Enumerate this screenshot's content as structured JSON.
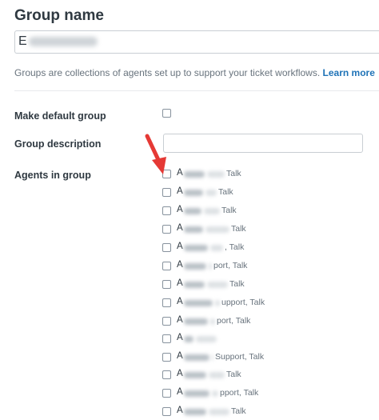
{
  "group_name": {
    "label": "Group name",
    "value_visible_prefix": "E"
  },
  "help": {
    "text": "Groups are collections of agents set up to support your ticket workflows.",
    "link": "Learn more"
  },
  "default_group": {
    "label": "Make default group"
  },
  "description": {
    "label": "Group description",
    "value": ""
  },
  "agents": {
    "label": "Agents in group",
    "items": [
      {
        "initial": "A",
        "role": "Talk"
      },
      {
        "initial": "A",
        "role": "Talk"
      },
      {
        "initial": "A",
        "role": "Talk"
      },
      {
        "initial": "A",
        "role": "Talk"
      },
      {
        "initial": "A",
        "role": ", Talk"
      },
      {
        "initial": "A",
        "role": "port, Talk"
      },
      {
        "initial": "A",
        "role": "Talk"
      },
      {
        "initial": "A",
        "role": "upport, Talk"
      },
      {
        "initial": "A",
        "role": "port, Talk"
      },
      {
        "initial": "A",
        "role": ""
      },
      {
        "initial": "A",
        "role": "Support, Talk"
      },
      {
        "initial": "A",
        "role": "Talk"
      },
      {
        "initial": "A",
        "role": "pport, Talk"
      },
      {
        "initial": "A",
        "role": "Talk"
      }
    ]
  },
  "colors": {
    "link": "#1f73b7",
    "arrow": "#e53935",
    "text": "#2f3941",
    "muted": "#68737d"
  }
}
